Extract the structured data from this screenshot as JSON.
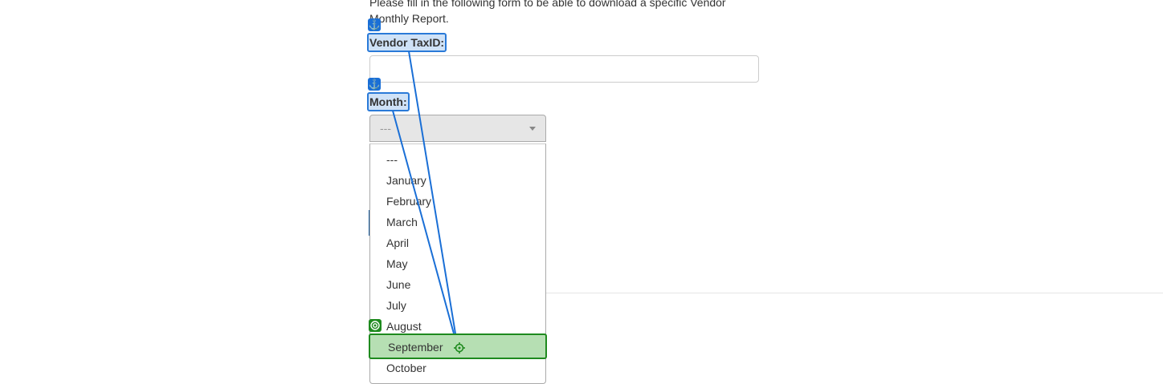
{
  "form": {
    "intro_text": "Please fill in the following form to be able to download a specific Vendor Monthly Report.",
    "vendor_taxid_label": "Vendor TaxID:",
    "vendor_taxid_value": "",
    "month_label": "Month:",
    "month_selected": "---"
  },
  "dropdown": {
    "options": [
      "---",
      "January",
      "February",
      "March",
      "April",
      "May",
      "June",
      "July",
      "August",
      "September",
      "October"
    ],
    "highlighted": "September"
  },
  "annotation": {
    "anchor_icon": "anchor-icon",
    "target_icon": "crosshair-target-icon",
    "link_color": "#1a6fd6",
    "highlight_color": "#1e8a1e"
  }
}
